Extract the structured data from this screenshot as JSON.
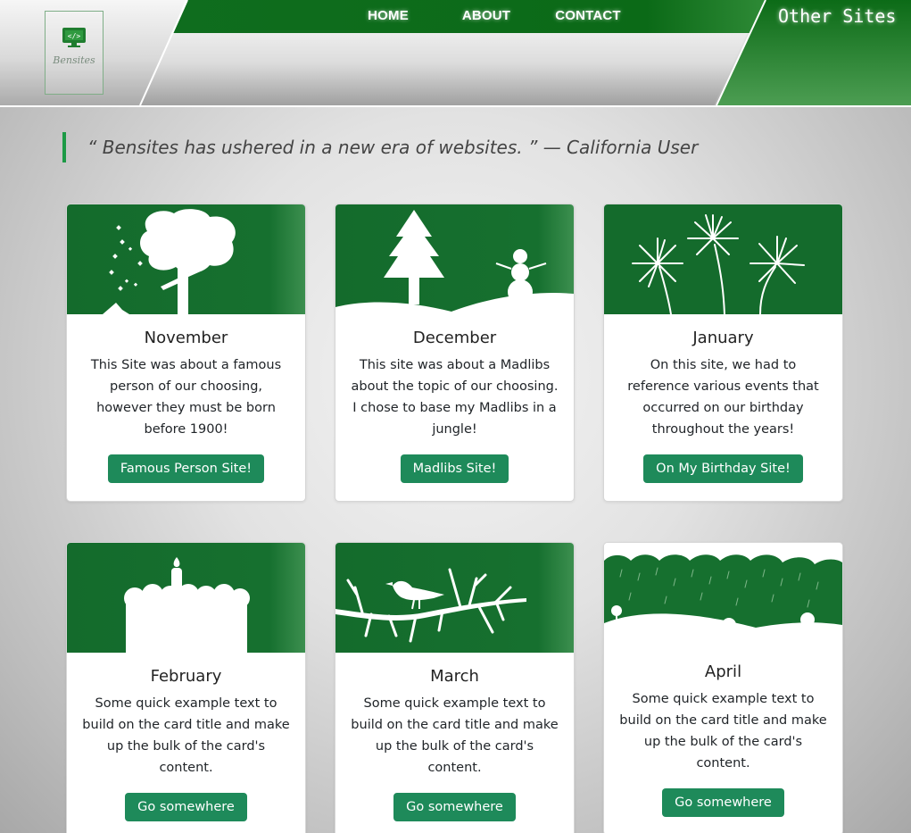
{
  "brand": {
    "name": "Bensites"
  },
  "nav": [
    {
      "label": "HOME"
    },
    {
      "label": "ABOUT"
    },
    {
      "label": "CONTACT"
    }
  ],
  "other_sites": "Other Sites",
  "quote": "“ Bensites has ushered in a new era of websites. ” — California User",
  "colors": {
    "brand_green": "#14682a",
    "button_green": "#1e8a5a",
    "quote_bar": "#1c9a45"
  },
  "cards": [
    {
      "title": "November",
      "text": "This Site was about a famous person of our choosing, however they must be born before 1900!",
      "button": "Famous Person Site!",
      "image": "tree-snow-illustration"
    },
    {
      "title": "December",
      "text": "This site was about a Madlibs about the topic of our choosing. I chose to base my Madlibs in a jungle!",
      "button": "Madlibs Site!",
      "image": "pine-tree-snowman-illustration"
    },
    {
      "title": "January",
      "text": "On this site, we had to reference various events that occurred on our birthday throughout the years!",
      "button": "On My Birthday Site!",
      "image": "fireworks-illustration"
    },
    {
      "title": "February",
      "text": "Some quick example text to build on the card title and make up the bulk of the card's content.",
      "button": "Go somewhere",
      "image": "birthday-cake-illustration"
    },
    {
      "title": "March",
      "text": "Some quick example text to build on the card title and make up the bulk of the card's content.",
      "button": "Go somewhere",
      "image": "bird-branch-illustration"
    },
    {
      "title": "April",
      "text": "Some quick example text to build on the card title and make up the bulk of the card's content.",
      "button": "Go somewhere",
      "image": "rain-clouds-illustration"
    }
  ]
}
